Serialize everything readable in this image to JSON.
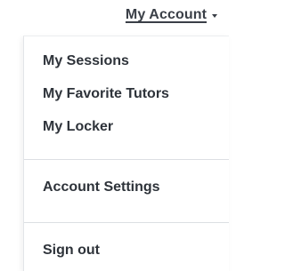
{
  "header": {
    "account_label": "My Account"
  },
  "menu": {
    "primary": [
      {
        "label": "My Sessions"
      },
      {
        "label": "My Favorite Tutors"
      },
      {
        "label": "My Locker"
      }
    ],
    "settings_label": "Account Settings",
    "signout_label": "Sign out"
  },
  "icons": {
    "caret": "chevron-down-icon"
  },
  "colors": {
    "text": "#2e333a",
    "divider": "#dcdfe3"
  }
}
